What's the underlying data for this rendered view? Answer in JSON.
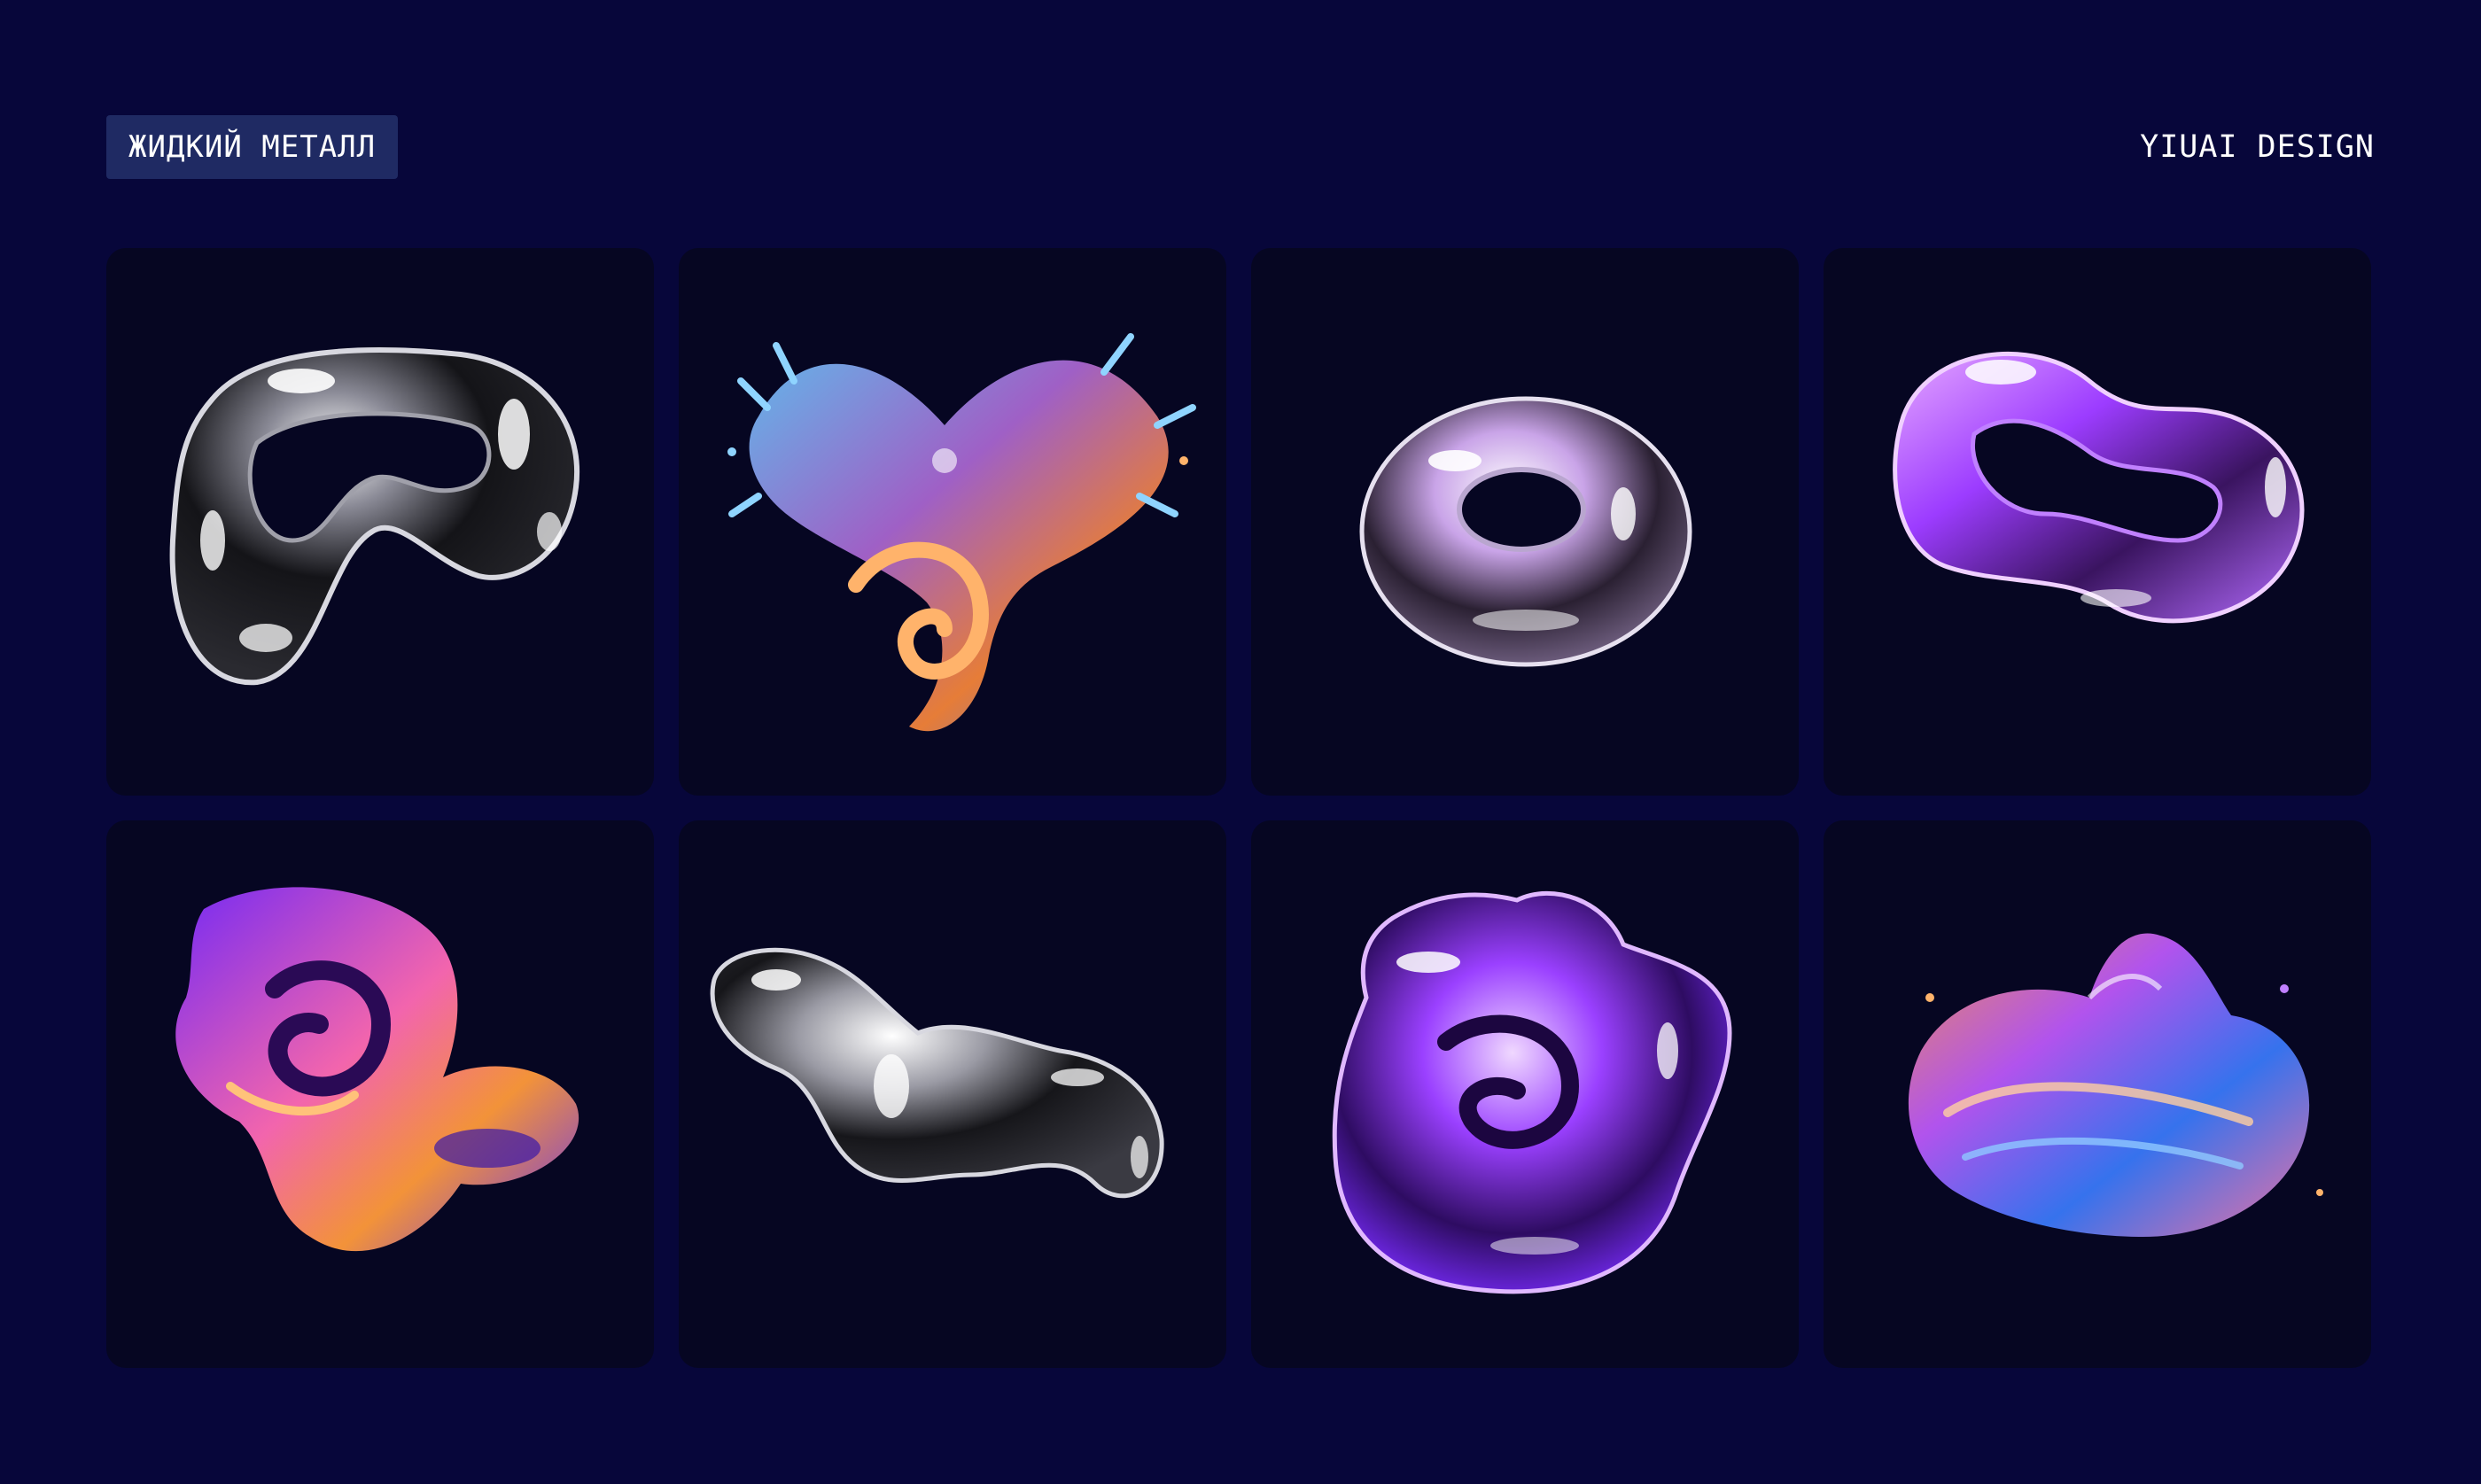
{
  "header": {
    "tag_label": "ЖИДКИЙ МЕТАЛЛ",
    "brand_label": "YIUAI DESIGN"
  },
  "colors": {
    "background": "#07063a",
    "tag_background": "#1f2a63",
    "tile_background": "#060622",
    "chrome": "#c9c9d6",
    "violet": "#8a3cff",
    "orange": "#ff8a3a",
    "cyan": "#5ab8ff"
  },
  "gallery": {
    "items": [
      {
        "icon": "chrome-loop-icon"
      },
      {
        "icon": "iridescent-splash-heart-icon"
      },
      {
        "icon": "chrome-torus-icon"
      },
      {
        "icon": "violet-chrome-loop-icon"
      },
      {
        "icon": "purple-orange-swirl-icon"
      },
      {
        "icon": "chrome-blob-icon"
      },
      {
        "icon": "violet-chrome-blob-icon"
      },
      {
        "icon": "iridescent-wave-icon"
      }
    ]
  }
}
